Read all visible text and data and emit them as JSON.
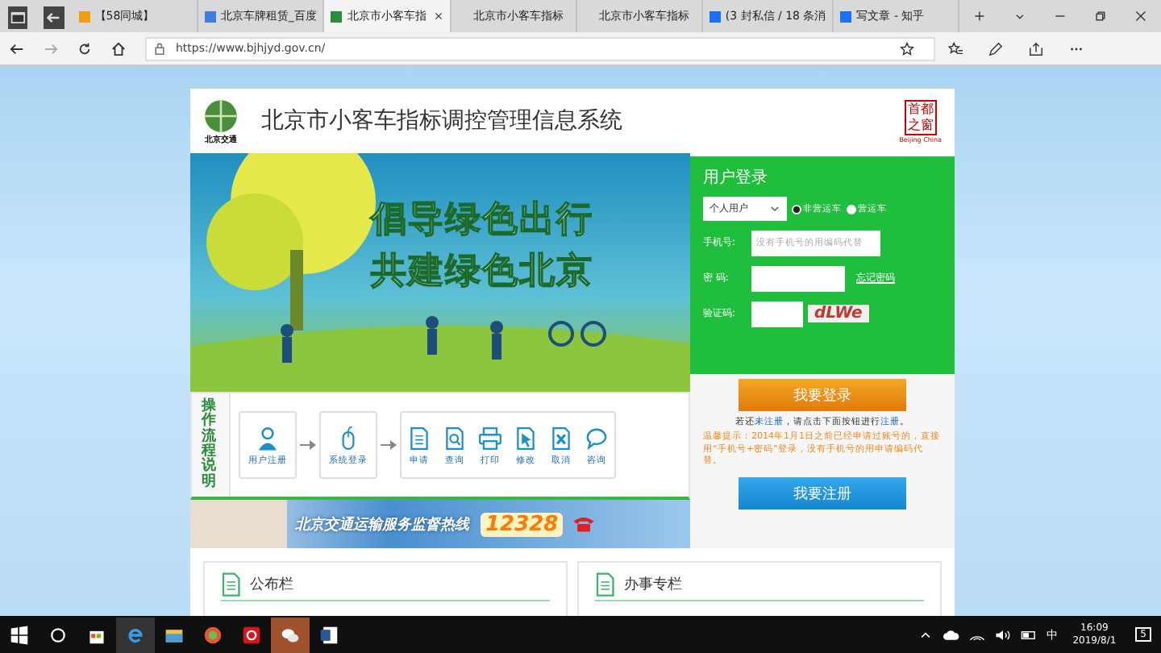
{
  "browser": {
    "tabs": [
      {
        "label": "【58同城】",
        "selected": false
      },
      {
        "label": "北京车牌租赁_百度",
        "selected": false
      },
      {
        "label": "北京市小客车指",
        "selected": true
      },
      {
        "label": "北京市小客车指标",
        "selected": false
      },
      {
        "label": "北京市小客车指标",
        "selected": false
      },
      {
        "label": "(3 封私信 / 18 条消",
        "selected": false
      },
      {
        "label": "写文章 - 知乎",
        "selected": false
      }
    ],
    "url": "https://www.bjhjyd.gov.cn/"
  },
  "header": {
    "logo_caption": "北京交通",
    "title": "北京市小客车指标调控管理信息系统",
    "badge_text": "首都之窗",
    "badge_caption": "Beijing China"
  },
  "banner": {
    "slogans": [
      "倡导绿色出行",
      "共建绿色北京"
    ]
  },
  "login": {
    "title": "用户登录",
    "user_type": "个人用户",
    "vehicle_types": [
      {
        "label": "非营运车",
        "selected": true
      },
      {
        "label": "营运车",
        "selected": false
      }
    ],
    "phone_label": "手机号:",
    "phone_placeholder": "没有手机号的用编码代替",
    "password_label": "密 码:",
    "forgot_link": "忘记密码",
    "captcha_label": "验证码:",
    "captcha": "dLWe",
    "login_button": "我要登录",
    "register_hint": [
      "若还",
      "未注册",
      "，请点击下面按钮进行",
      "注册",
      "。"
    ],
    "notice": "温馨提示：2014年1月1日之前已经申请过账号的，直接用“手机号+密码”登录，没有手机号的用申请编码代替。",
    "register_button": "我要注册"
  },
  "flow": {
    "title": "操作流程说明",
    "steps": [
      "用户注册",
      "系统登录"
    ],
    "actions": [
      "申请",
      "查询",
      "打印",
      "修改",
      "取消",
      "咨询"
    ]
  },
  "hotline": {
    "text": "北京交通运输服务监督热线",
    "number": "12328"
  },
  "panels": [
    {
      "title": "公布栏"
    },
    {
      "title": "办事专栏"
    }
  ],
  "taskbar": {
    "ime": "中",
    "time": "16:09",
    "date": "2019/8/1",
    "notifications": "5"
  }
}
